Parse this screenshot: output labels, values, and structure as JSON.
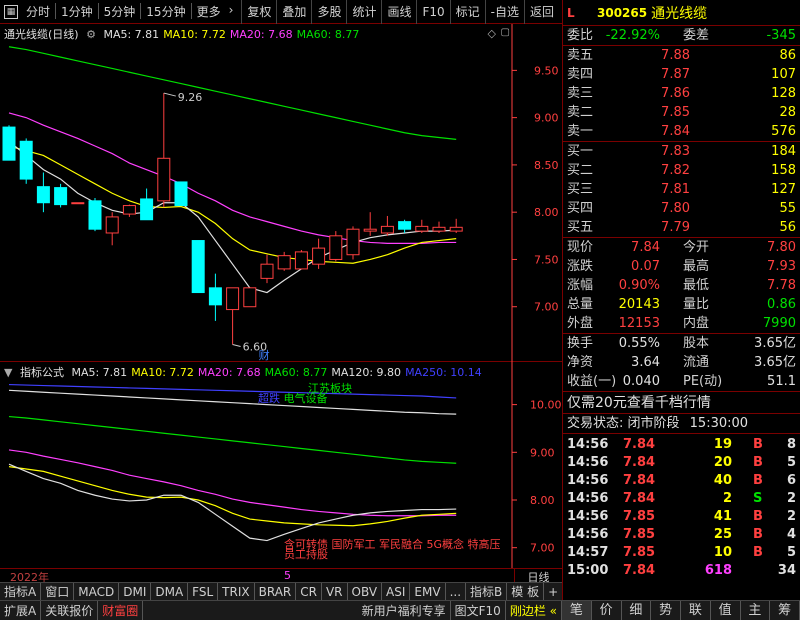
{
  "toolbar": {
    "left_items": [
      "分时",
      "1分钟",
      "5分钟",
      "15分钟",
      "更多"
    ],
    "more_arrow": "›",
    "buttons": [
      "复权",
      "叠加",
      "多股",
      "统计",
      "画线",
      "F10",
      "标记",
      "-自选",
      "返回"
    ]
  },
  "kline_panel": {
    "title": "通光线缆(日线)",
    "ma_labels": [
      {
        "text": "MA5: 7.81",
        "color": "#e0e0e0"
      },
      {
        "text": "MA10: 7.72",
        "color": "#ffff00"
      },
      {
        "text": "MA20: 7.68",
        "color": "#ff40ff"
      },
      {
        "text": "MA60: 8.77",
        "color": "#00e000"
      }
    ],
    "price_labels": [
      "9.50",
      "9.00",
      "8.50",
      "8.00",
      "7.50",
      "7.00"
    ],
    "high_label": "9.26",
    "low_label": "6.60",
    "cai_label": "财",
    "colors": {
      "up": "#ff4040",
      "down": "#00ffff",
      "ma5": "#e0e0e0",
      "ma10": "#ffff00",
      "ma20": "#ff40ff",
      "ma60": "#00e000",
      "axis": "#ff4040"
    }
  },
  "indicator_panel": {
    "title": "指标公式",
    "ma_labels": [
      {
        "text": "MA5: 7.81",
        "color": "#e0e0e0"
      },
      {
        "text": "MA10: 7.72",
        "color": "#ffff00"
      },
      {
        "text": "MA20: 7.68",
        "color": "#ff40ff"
      },
      {
        "text": "MA60: 8.77",
        "color": "#00e000"
      },
      {
        "text": "MA120: 9.80",
        "color": "#e0e0e0"
      },
      {
        "text": "MA250: 10.14",
        "color": "#4040ff"
      }
    ],
    "price_labels": [
      "10.00",
      "9.00",
      "8.00",
      "7.00"
    ],
    "tag_top_1": "江苏板块",
    "tag_top_2": "电气设备",
    "tag_top_3": "超跌",
    "tag_bottom_1": "含可转债 国防军工 军民融合 5G概念 特高压",
    "tag_bottom_2": "员工持股"
  },
  "date_axis": {
    "year": "2022年",
    "month": "5",
    "right_label": "日线"
  },
  "bottom_tabs_1": [
    "指标A",
    "窗口",
    "MACD",
    "DMI",
    "DMA",
    "FSL",
    "TRIX",
    "BRAR",
    "CR",
    "VR",
    "OBV",
    "ASI",
    "EMV",
    "...",
    "指标B",
    "模 板",
    "+",
    "-"
  ],
  "bottom_tabs_2": [
    "扩展A",
    "关联报价",
    "财富圈"
  ],
  "bottom_tabs_2_right": [
    "新用户福利专享",
    "图文F10",
    "刚边栏 «"
  ],
  "quote": {
    "market": "L",
    "code": "300265",
    "name": "通光线缆",
    "weibi_label": "委比",
    "weibi": "-22.92%",
    "weicha_label": "委差",
    "weicha": "-345",
    "asks": [
      {
        "label": "卖五",
        "price": "7.88",
        "vol": "86"
      },
      {
        "label": "卖四",
        "price": "7.87",
        "vol": "107"
      },
      {
        "label": "卖三",
        "price": "7.86",
        "vol": "128"
      },
      {
        "label": "卖二",
        "price": "7.85",
        "vol": "28"
      },
      {
        "label": "卖一",
        "price": "7.84",
        "vol": "576"
      }
    ],
    "bids": [
      {
        "label": "买一",
        "price": "7.83",
        "vol": "184"
      },
      {
        "label": "买二",
        "price": "7.82",
        "vol": "158"
      },
      {
        "label": "买三",
        "price": "7.81",
        "vol": "127"
      },
      {
        "label": "买四",
        "price": "7.80",
        "vol": "55"
      },
      {
        "label": "买五",
        "price": "7.79",
        "vol": "56"
      }
    ],
    "stats1": [
      {
        "a": "现价",
        "b": "7.84",
        "bc": "r",
        "c": "今开",
        "d": "7.80",
        "dc": "r"
      },
      {
        "a": "涨跌",
        "b": "0.07",
        "bc": "r",
        "c": "最高",
        "d": "7.93",
        "dc": "r"
      },
      {
        "a": "涨幅",
        "b": "0.90%",
        "bc": "r",
        "c": "最低",
        "d": "7.78",
        "dc": "r"
      },
      {
        "a": "总量",
        "b": "20143",
        "bc": "y",
        "c": "量比",
        "d": "0.86",
        "dc": "g"
      },
      {
        "a": "外盘",
        "b": "12153",
        "bc": "r",
        "c": "内盘",
        "d": "7990",
        "dc": "g"
      }
    ],
    "stats2": [
      {
        "a": "换手",
        "b": "0.55%",
        "bc": "w",
        "c": "股本",
        "d": "3.65亿",
        "dc": "w"
      },
      {
        "a": "净资",
        "b": "3.64",
        "bc": "w",
        "c": "流通",
        "d": "3.65亿",
        "dc": "w"
      },
      {
        "a": "收益(一)",
        "b": "0.040",
        "bc": "w",
        "c": "PE(动)",
        "d": "51.1",
        "dc": "w"
      }
    ],
    "promo": "仅需20元查看千档行情",
    "trade_status_label": "交易状态: 闭市阶段",
    "trade_status_time": "15:30:00",
    "ticks": [
      {
        "t": "14:56",
        "p": "7.84",
        "v": "19",
        "s": "B",
        "n": "8",
        "pc": "r",
        "vc": "y",
        "sc": "r"
      },
      {
        "t": "14:56",
        "p": "7.84",
        "v": "20",
        "s": "B",
        "n": "5",
        "pc": "r",
        "vc": "y",
        "sc": "r"
      },
      {
        "t": "14:56",
        "p": "7.84",
        "v": "40",
        "s": "B",
        "n": "6",
        "pc": "r",
        "vc": "y",
        "sc": "r"
      },
      {
        "t": "14:56",
        "p": "7.84",
        "v": "2",
        "s": "S",
        "n": "2",
        "pc": "r",
        "vc": "y",
        "sc": "g"
      },
      {
        "t": "14:56",
        "p": "7.85",
        "v": "41",
        "s": "B",
        "n": "2",
        "pc": "r",
        "vc": "y",
        "sc": "r"
      },
      {
        "t": "14:56",
        "p": "7.85",
        "v": "25",
        "s": "B",
        "n": "4",
        "pc": "r",
        "vc": "y",
        "sc": "r"
      },
      {
        "t": "14:57",
        "p": "7.85",
        "v": "10",
        "s": "B",
        "n": "5",
        "pc": "r",
        "vc": "y",
        "sc": "r"
      },
      {
        "t": "15:00",
        "p": "7.84",
        "v": "618",
        "s": "",
        "n": "34",
        "pc": "r",
        "vc": "m",
        "sc": "r"
      }
    ],
    "side_tabs": [
      "笔",
      "价",
      "细",
      "势",
      "联",
      "值",
      "主",
      "筹"
    ]
  },
  "chart_data": {
    "type": "candlestick",
    "title": "通光线缆(日线)",
    "y_range": [
      6.5,
      9.8
    ],
    "candles": [
      {
        "o": 8.9,
        "h": 8.92,
        "l": 8.7,
        "c": 8.55
      },
      {
        "o": 8.75,
        "h": 8.78,
        "l": 8.3,
        "c": 8.35
      },
      {
        "o": 8.27,
        "h": 8.42,
        "l": 8.0,
        "c": 8.1
      },
      {
        "o": 8.26,
        "h": 8.3,
        "l": 8.05,
        "c": 8.08
      },
      {
        "o": 8.1,
        "h": 8.1,
        "l": 8.1,
        "c": 8.1
      },
      {
        "o": 8.12,
        "h": 8.15,
        "l": 7.8,
        "c": 7.82
      },
      {
        "o": 7.78,
        "h": 8.0,
        "l": 7.65,
        "c": 7.95
      },
      {
        "o": 7.98,
        "h": 8.08,
        "l": 7.95,
        "c": 8.07
      },
      {
        "o": 8.14,
        "h": 8.25,
        "l": 8.1,
        "c": 7.92
      },
      {
        "o": 8.12,
        "h": 9.26,
        "l": 8.05,
        "c": 8.57
      },
      {
        "o": 8.32,
        "h": 8.32,
        "l": 8.07,
        "c": 8.07
      },
      {
        "o": 7.7,
        "h": 7.7,
        "l": 7.15,
        "c": 7.15
      },
      {
        "o": 7.2,
        "h": 7.35,
        "l": 6.85,
        "c": 7.02
      },
      {
        "o": 6.97,
        "h": 7.2,
        "l": 6.6,
        "c": 7.2
      },
      {
        "o": 7.0,
        "h": 7.2,
        "l": 7.0,
        "c": 7.2
      },
      {
        "o": 7.3,
        "h": 7.55,
        "l": 7.25,
        "c": 7.45
      },
      {
        "o": 7.4,
        "h": 7.58,
        "l": 7.38,
        "c": 7.54
      },
      {
        "o": 7.4,
        "h": 7.6,
        "l": 7.4,
        "c": 7.58
      },
      {
        "o": 7.45,
        "h": 7.72,
        "l": 7.4,
        "c": 7.62
      },
      {
        "o": 7.5,
        "h": 7.8,
        "l": 7.48,
        "c": 7.75
      },
      {
        "o": 7.55,
        "h": 7.85,
        "l": 7.5,
        "c": 7.82
      },
      {
        "o": 7.8,
        "h": 8.0,
        "l": 7.75,
        "c": 7.82
      },
      {
        "o": 7.78,
        "h": 7.96,
        "l": 7.75,
        "c": 7.85
      },
      {
        "o": 7.9,
        "h": 7.92,
        "l": 7.78,
        "c": 7.82
      },
      {
        "o": 7.8,
        "h": 7.92,
        "l": 7.78,
        "c": 7.85
      },
      {
        "o": 7.8,
        "h": 7.9,
        "l": 7.78,
        "c": 7.84
      },
      {
        "o": 7.8,
        "h": 7.93,
        "l": 7.78,
        "c": 7.84
      }
    ],
    "ma5": [
      8.75,
      8.6,
      8.45,
      8.35,
      8.2,
      8.1,
      8.02,
      7.98,
      8.0,
      8.1,
      8.1,
      7.95,
      7.7,
      7.45,
      7.2,
      7.15,
      7.28,
      7.4,
      7.52,
      7.6,
      7.68,
      7.73,
      7.76,
      7.78,
      7.8,
      7.8,
      7.81
    ],
    "ma10": [
      8.7,
      8.65,
      8.6,
      8.5,
      8.4,
      8.3,
      8.2,
      8.12,
      8.06,
      8.05,
      8.06,
      8.0,
      7.88,
      7.72,
      7.6,
      7.56,
      7.52,
      7.5,
      7.48,
      7.47,
      7.46,
      7.5,
      7.55,
      7.62,
      7.68,
      7.7,
      7.72
    ],
    "ma20": [
      9.05,
      9.0,
      8.92,
      8.85,
      8.78,
      8.7,
      8.62,
      8.52,
      8.45,
      8.38,
      8.3,
      8.2,
      8.12,
      8.02,
      7.95,
      7.9,
      7.85,
      7.8,
      7.76,
      7.73,
      7.7,
      7.68,
      7.67,
      7.67,
      7.67,
      7.68,
      7.68
    ],
    "ma60": [
      9.75,
      9.72,
      9.68,
      9.64,
      9.6,
      9.56,
      9.52,
      9.48,
      9.44,
      9.4,
      9.36,
      9.32,
      9.28,
      9.24,
      9.2,
      9.16,
      9.12,
      9.08,
      9.04,
      9.0,
      8.96,
      8.92,
      8.88,
      8.84,
      8.81,
      8.79,
      8.77
    ],
    "ind_y_range": [
      6.7,
      10.6
    ],
    "ind_ma250": [
      10.42,
      10.41,
      10.4,
      10.39,
      10.38,
      10.37,
      10.36,
      10.35,
      10.34,
      10.33,
      10.32,
      10.31,
      10.3,
      10.29,
      10.28,
      10.27,
      10.26,
      10.25,
      10.24,
      10.23,
      10.22,
      10.21,
      10.2,
      10.19,
      10.18,
      10.16,
      10.14
    ],
    "ind_ma120": [
      10.3,
      10.28,
      10.26,
      10.24,
      10.22,
      10.2,
      10.18,
      10.16,
      10.14,
      10.12,
      10.1,
      10.08,
      10.06,
      10.04,
      10.02,
      10.0,
      9.98,
      9.96,
      9.94,
      9.92,
      9.9,
      9.88,
      9.86,
      9.84,
      9.83,
      9.81,
      9.8
    ]
  }
}
